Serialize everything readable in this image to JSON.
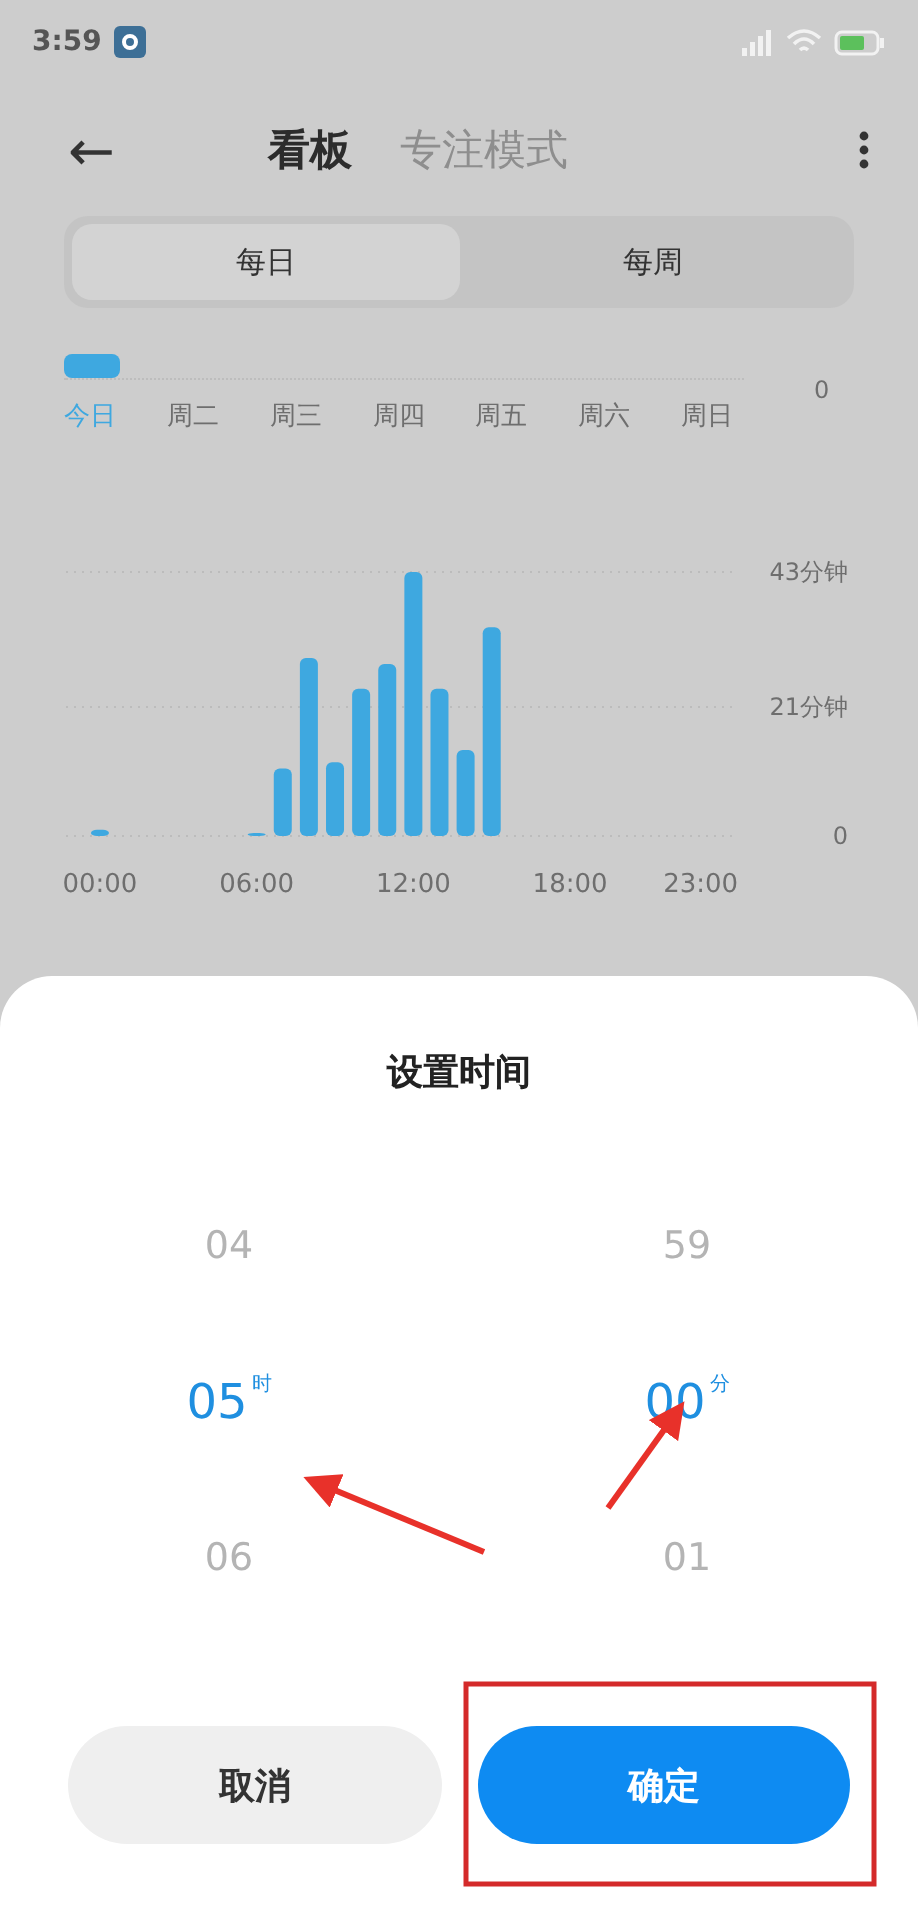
{
  "status_bar": {
    "time": "3:59"
  },
  "header": {
    "back_icon": "←",
    "tabs": [
      {
        "label": "看板",
        "selected": true
      },
      {
        "label": "专注模式",
        "selected": false
      }
    ]
  },
  "period_switch": [
    {
      "label": "每日",
      "selected": true
    },
    {
      "label": "每周",
      "selected": false
    }
  ],
  "week_strip": {
    "axis_label": "0",
    "days": [
      {
        "label": "今日",
        "selected": true
      },
      {
        "label": "周二",
        "selected": false
      },
      {
        "label": "周三",
        "selected": false
      },
      {
        "label": "周四",
        "selected": false
      },
      {
        "label": "周五",
        "selected": false
      },
      {
        "label": "周六",
        "selected": false
      },
      {
        "label": "周日",
        "selected": false
      }
    ]
  },
  "hour_chart": {
    "chart_data": {
      "type": "bar",
      "x": [
        0,
        1,
        2,
        3,
        4,
        5,
        6,
        7,
        8,
        9,
        10,
        11,
        12,
        13,
        14,
        15,
        16,
        17,
        18,
        19,
        20,
        21,
        22,
        23
      ],
      "xlim": [
        -1.3,
        24.2
      ],
      "series": [
        {
          "color": "#3ea8e0",
          "values": [
            1,
            0,
            0,
            0,
            0,
            0,
            0.3,
            11,
            29,
            12,
            24,
            28,
            43,
            24,
            14,
            34,
            0,
            0,
            0,
            0,
            0,
            0,
            0,
            0
          ]
        }
      ],
      "ylim": [
        0,
        43
      ],
      "yticks": [
        {
          "value": 0,
          "label": "0"
        },
        {
          "value": 21,
          "label": "21分钟"
        },
        {
          "value": 43,
          "label": "43分钟"
        }
      ],
      "xticks": [
        {
          "value": 0,
          "label": "00:00"
        },
        {
          "value": 6,
          "label": "06:00"
        },
        {
          "value": 12,
          "label": "12:00"
        },
        {
          "value": 18,
          "label": "18:00"
        },
        {
          "value": 23,
          "label": "23:00"
        }
      ]
    }
  },
  "dialog": {
    "title": "设置时间",
    "picker": [
      {
        "items": [
          {
            "value": "04",
            "selected": false
          },
          {
            "value": "05",
            "selected": true,
            "unit": "时"
          },
          {
            "value": "06",
            "selected": false
          }
        ]
      },
      {
        "items": [
          {
            "value": "59",
            "selected": false
          },
          {
            "value": "00",
            "selected": true,
            "unit": "分"
          },
          {
            "value": "01",
            "selected": false
          }
        ]
      }
    ],
    "buttons": [
      {
        "label": "取消",
        "kind": "secondary"
      },
      {
        "label": "确定",
        "kind": "primary"
      }
    ]
  }
}
